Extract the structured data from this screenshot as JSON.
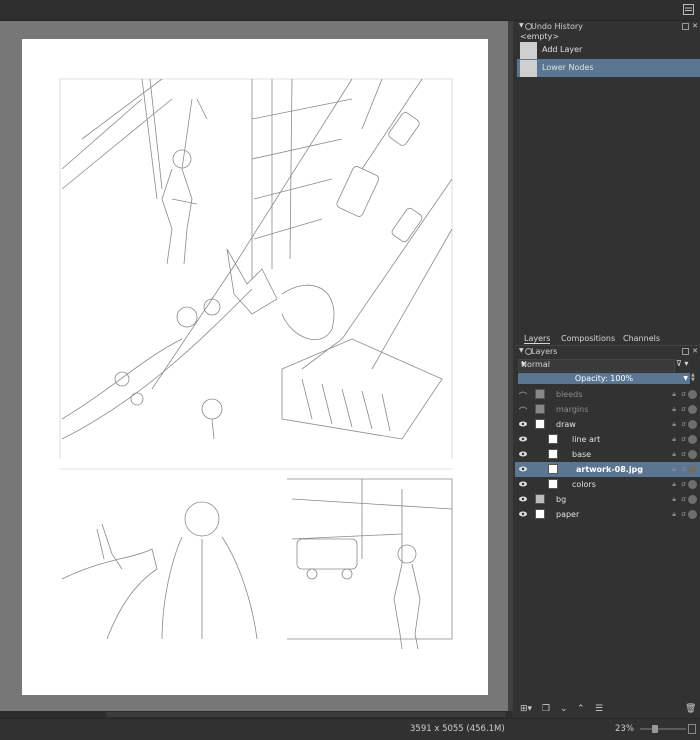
{
  "undo": {
    "title": "Undo History",
    "empty_label": "<empty>",
    "items": [
      {
        "label": "Add Layer"
      },
      {
        "label": "Lower Nodes"
      }
    ]
  },
  "tabs": [
    "Layers",
    "Compositions",
    "Channels"
  ],
  "layers_panel": {
    "title": "Layers",
    "blend_mode": "Normal",
    "opacity_label": "Opacity:  100%",
    "layers": [
      {
        "name": "bleeds"
      },
      {
        "name": "margins"
      },
      {
        "name": "draw"
      },
      {
        "name": "line art"
      },
      {
        "name": "base"
      },
      {
        "name": "artwork-08.jpg"
      },
      {
        "name": "colors"
      },
      {
        "name": "bg"
      },
      {
        "name": "paper"
      }
    ]
  },
  "status": {
    "image_size": "3591 x 5055 (456.1M)",
    "zoom": "23%"
  },
  "icons": [
    "menu-icon",
    "eye-icon",
    "lock-icon",
    "alpha-icon",
    "inherit-alpha-icon",
    "add-layer-icon",
    "duplicate-icon",
    "move-down-icon",
    "move-up-icon",
    "properties-icon",
    "delete-icon",
    "filter-icon"
  ]
}
